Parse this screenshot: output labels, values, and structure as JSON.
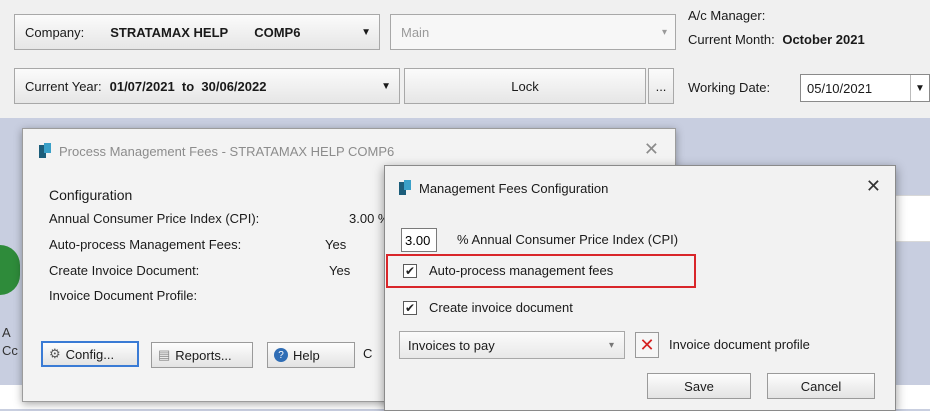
{
  "header": {
    "company_label": "Company:",
    "company_name": "STRATAMAX HELP",
    "company_code": "COMP6",
    "building_placeholder": "Main",
    "year_label": "Current Year:",
    "year_range": "01/07/2021  to  30/06/2022",
    "lock_label": "Lock",
    "ellipsis_label": "...",
    "ac_manager_label": "A/c Manager:",
    "current_month_label": "Current Month:",
    "current_month_value": "October 2021",
    "working_date_label": "Working Date:",
    "working_date_value": "05/10/2021"
  },
  "background": {
    "side_letters": [
      "A",
      "Cc"
    ],
    "partial_letter": "C"
  },
  "process_dialog": {
    "title": "Process Management Fees - STRATAMAX HELP COMP6",
    "section": "Configuration",
    "rows": [
      {
        "label": "Annual Consumer Price Index (CPI):",
        "value": "3.00 %"
      },
      {
        "label": "Auto-process Management Fees:",
        "value": "Yes"
      },
      {
        "label": "Create Invoice Document:",
        "value": "Yes"
      },
      {
        "label": "Invoice Document Profile:",
        "value": ""
      }
    ],
    "buttons": {
      "config": "Config...",
      "reports": "Reports...",
      "help": "Help"
    }
  },
  "config_modal": {
    "title": "Management Fees Configuration",
    "cpi_value": "3.00",
    "cpi_label": "% Annual Consumer Price Index (CPI)",
    "auto_process_label": "Auto-process management fees",
    "auto_process_checked": true,
    "create_invoice_label": "Create invoice document",
    "create_invoice_checked": true,
    "profile_selected": "Invoices to pay",
    "profile_label": "Invoice document profile",
    "save_label": "Save",
    "cancel_label": "Cancel"
  },
  "colors": {
    "highlight": "#d9262a",
    "focus": "#3a7bd5",
    "accent_icon": "#3aa0c8"
  }
}
